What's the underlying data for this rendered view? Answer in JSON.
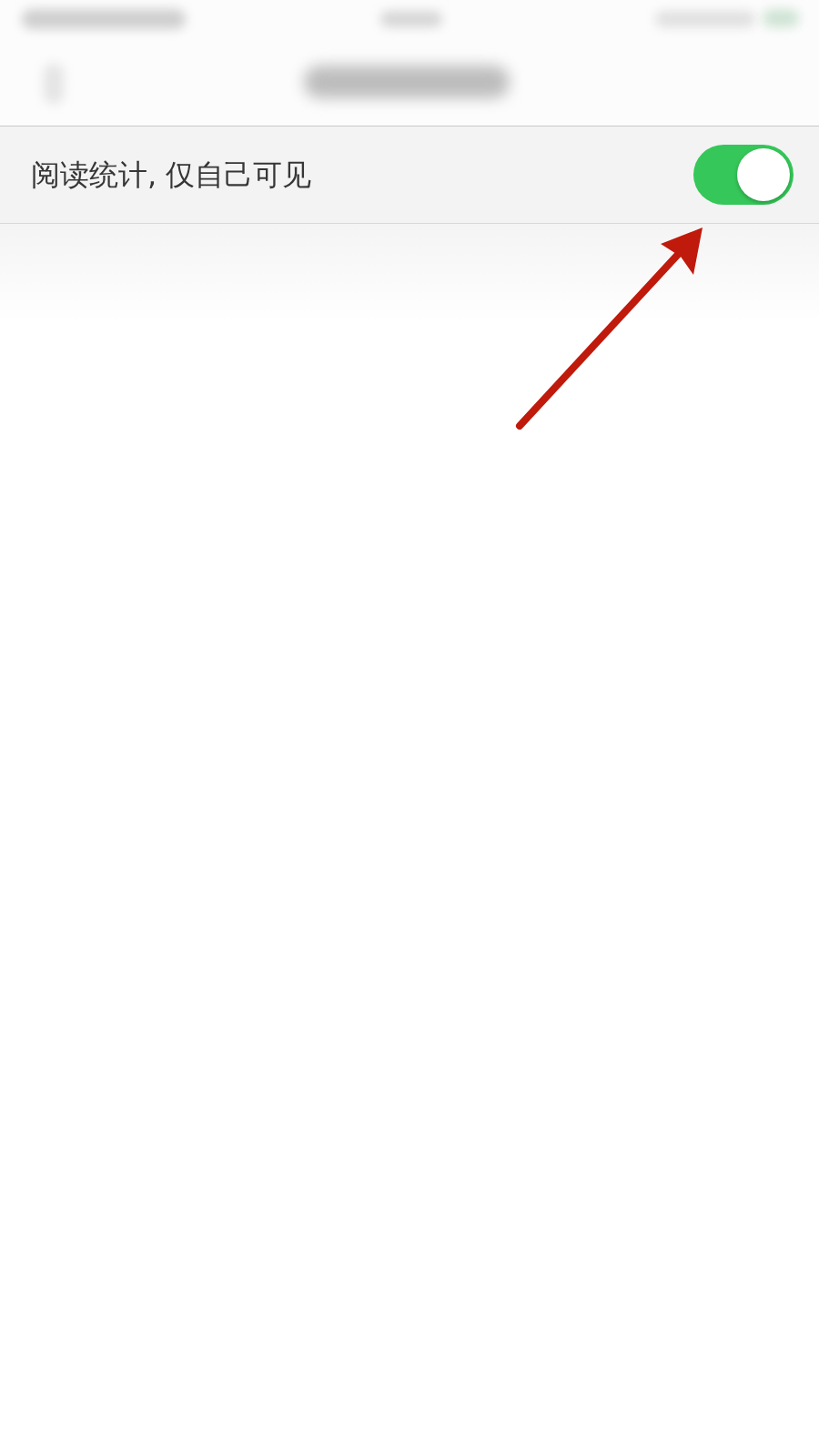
{
  "setting": {
    "label": "阅读统计, 仅自己可见",
    "on": true
  }
}
